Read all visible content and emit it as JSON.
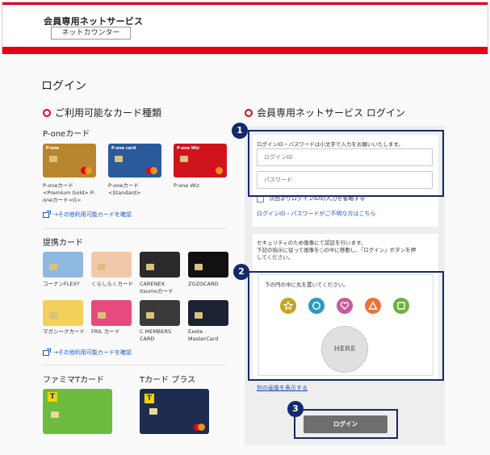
{
  "header": {
    "title": "会員専用ネットサービス",
    "badge": "ネットカウンター"
  },
  "page": {
    "title": "ログイン"
  },
  "left": {
    "section_title": "ご利用可能なカード種類",
    "groups": {
      "pone": {
        "title": "P-oneカード",
        "cards": [
          {
            "caption": "P-oneカード\n<Premium Gold> P-\noneカード<G>",
            "brand": "P-one",
            "color": "#b8862e"
          },
          {
            "caption": "P-oneカード\n<Standard>",
            "brand": "P-one card",
            "color": "#2a5a9c"
          },
          {
            "caption": "P-one Wiz",
            "brand": "P-one Wiz",
            "color": "#d0141e"
          }
        ],
        "link": "→その他利用可能カードを確認"
      },
      "partner": {
        "title": "提携カード",
        "cards": [
          {
            "caption": "コーナンFLEXY",
            "color": "#8fb8e0"
          },
          {
            "caption": "くらしらくカード",
            "color": "#f2c9a8"
          },
          {
            "caption": "CARENEX\nitsumoカード",
            "color": "#2a2a2a"
          },
          {
            "caption": "ZOZOCARD",
            "color": "#111111"
          },
          {
            "caption": "マガシークカード",
            "color": "#f3d05a"
          },
          {
            "caption": "FRIL カード",
            "color": "#e84a7f"
          },
          {
            "caption": "C MEMBERS\nCARD",
            "color": "#3a3a3a"
          },
          {
            "caption": "Exote\nMasterCard",
            "color": "#1d2233"
          }
        ],
        "link": "→その他利用可能カードを確認"
      },
      "famima": {
        "title": "ファミマTカード",
        "color": "#6dbb3f"
      },
      "tplus": {
        "title": "Tカード プラス",
        "color": "#1e2c4f"
      }
    }
  },
  "right": {
    "section_title": "会員専用ネットサービス ログイン",
    "instruction": "ログインID・パスワードは小文字で入力をお願いいたします。",
    "id_placeholder": "ログインID",
    "pw_placeholder": "パスワード",
    "remember_label": "次回よりログインIDの入力を省略する",
    "forgot_link": "ログインID・パスワードがご不明な方はこちら",
    "security_text": "セキュリティのため画像にて認証を行います。\n下記の指示に従って画像を○の中に移動し、「ログイン」ボタンを押\nしてください。",
    "pattern_prompt": "下の円の中に丸を置いてください。",
    "shapes": [
      {
        "name": "star",
        "color": "#c9a21e"
      },
      {
        "name": "circle",
        "color": "#2a9bc2"
      },
      {
        "name": "heart",
        "color": "#c85a9e"
      },
      {
        "name": "triangle",
        "color": "#e8743c"
      },
      {
        "name": "square",
        "color": "#6cb33e"
      }
    ],
    "drop_target": "HERE",
    "alt_link": "別の画像を表示する",
    "login_button": "ログイン"
  },
  "annotations": [
    "1",
    "2",
    "3"
  ],
  "colors": {
    "brand_red": "#e50012",
    "annotation": "#14296b",
    "link": "#1a56c4"
  }
}
